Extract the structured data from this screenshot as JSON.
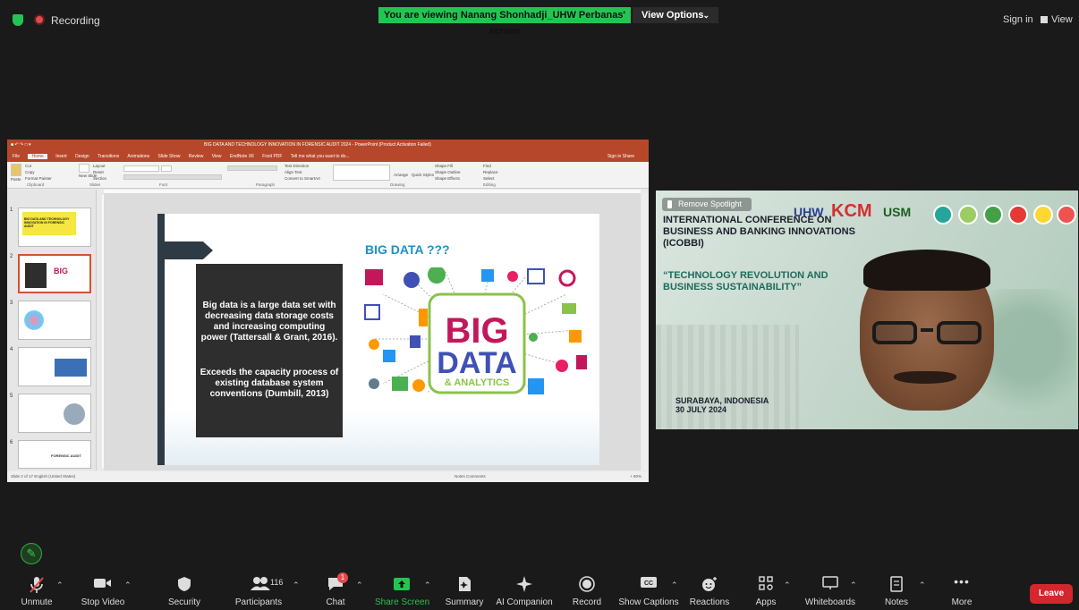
{
  "topbar": {
    "recording_label": "Recording",
    "viewing_banner": "You are viewing Nanang Shonhadji_UHW Perbanas' screen",
    "view_options": "View Options",
    "sign_in": "Sign in",
    "view": "View",
    "colors": {
      "banner": "#23c552",
      "record_dot": "#e5484d"
    }
  },
  "ppt": {
    "doc_title": "BIG DATA AND TECHNOLOGY INNOVATION IN FORENSIC AUDIT 2024 - PowerPoint (Product Activation Failed)",
    "menu": [
      "File",
      "Home",
      "Insert",
      "Design",
      "Transitions",
      "Animations",
      "Slide Show",
      "Review",
      "View",
      "EndNote X6",
      "Foxit PDF"
    ],
    "tell_me": "Tell me what you want to do...",
    "menu_right": "Sign in   Share",
    "ribbon_groups": [
      "Clipboard",
      "Slides",
      "Font",
      "Paragraph",
      "Drawing",
      "Editing"
    ],
    "ribbon_items": {
      "paste": "Paste",
      "cut": "Cut",
      "copy": "Copy",
      "format_painter": "Format Painter",
      "new_slide": "New Slide",
      "layout": "Layout",
      "reset": "Reset",
      "section": "Section",
      "text_direction": "Text Direction",
      "align_text": "Align Text",
      "convert_smartart": "Convert to SmartArt",
      "arrange": "Arrange",
      "quick_styles": "Quick Styles",
      "shape_fill": "Shape Fill",
      "shape_outline": "Shape Outline",
      "shape_effects": "Shape Effects",
      "find": "Find",
      "replace": "Replace",
      "select": "Select"
    },
    "thumb_numbers": [
      "1",
      "2",
      "3",
      "4",
      "5",
      "6"
    ],
    "thumb1_title": "BIG DATA AND TECHNOLOGY INNOVATION IN FORENSIC AUDIT",
    "thumb6_label": "FORENSIC AUDIT",
    "slide": {
      "title": "BIG DATA ???",
      "text1": "Big data is a large data set with decreasing data storage costs and increasing computing power (Tattersall & Grant, 2016).",
      "text2": "Exceeds the capacity process of existing database system conventions (Dumbill, 2013)",
      "art_big": "BIG",
      "art_data": "DATA",
      "art_analytics": "& ANALYTICS"
    },
    "status_left": "Slide 2 of 17    English (United States)",
    "status_right": "Notes   Comments",
    "status_zoom": "+ 60%"
  },
  "speaker": {
    "remove_spotlight": "Remove Spotlight",
    "conf_title": "INTERNATIONAL CONFERENCE ON BUSINESS AND BANKING INNOVATIONS (ICOBBI)",
    "conf_theme": "“TECHNOLOGY REVOLUTION AND BUSINESS SUSTAINABILITY”",
    "place": "SURABAYA, INDONESIA",
    "date": "30 JULY 2024",
    "logo_uhw": "UHW",
    "logo_kcm": "KCM",
    "logo_usm": "USM"
  },
  "toolbar": {
    "unmute": "Unmute",
    "stop_video": "Stop Video",
    "security": "Security",
    "participants": "Participants",
    "participants_count": "116",
    "chat": "Chat",
    "chat_badge": "1",
    "share_screen": "Share Screen",
    "summary": "Summary",
    "ai_companion": "AI Companion",
    "record": "Record",
    "show_captions": "Show Captions",
    "reactions": "Reactions",
    "apps": "Apps",
    "whiteboards": "Whiteboards",
    "notes": "Notes",
    "more": "More",
    "leave": "Leave",
    "colors": {
      "leave": "#d3262d",
      "share": "#23c552"
    }
  }
}
